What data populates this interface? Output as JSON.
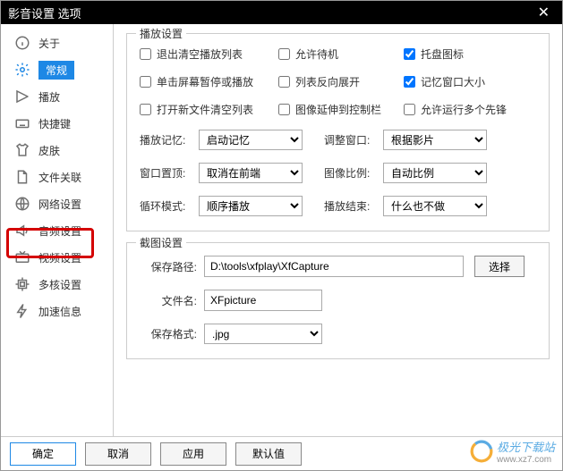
{
  "titlebar": {
    "title": "影音设置 选项"
  },
  "sidebar": {
    "items": [
      {
        "label": "关于"
      },
      {
        "label": "常规"
      },
      {
        "label": "播放"
      },
      {
        "label": "快捷键"
      },
      {
        "label": "皮肤"
      },
      {
        "label": "文件关联"
      },
      {
        "label": "网络设置"
      },
      {
        "label": "音频设置"
      },
      {
        "label": "视频设置"
      },
      {
        "label": "多核设置"
      },
      {
        "label": "加速信息"
      }
    ]
  },
  "playback": {
    "group_title": "播放设置",
    "checkboxes": {
      "clear_on_exit": "退出清空播放列表",
      "allow_standby": "允许待机",
      "tray_icon": "托盘图标",
      "click_pause": "单击屏幕暂停或播放",
      "list_reverse": "列表反向展开",
      "remember_size": "记忆窗口大小",
      "open_clear": "打开新文件清空列表",
      "extend_controls": "图像延伸到控制栏",
      "allow_multi": "允许运行多个先锋"
    },
    "selects": {
      "play_memory_label": "播放记忆:",
      "play_memory_value": "启动记忆",
      "adjust_window_label": "调整窗口:",
      "adjust_window_value": "根据影片",
      "window_top_label": "窗口置顶:",
      "window_top_value": "取消在前端",
      "image_ratio_label": "图像比例:",
      "image_ratio_value": "自动比例",
      "loop_mode_label": "循环模式:",
      "loop_mode_value": "顺序播放",
      "play_end_label": "播放结束:",
      "play_end_value": "什么也不做"
    }
  },
  "screenshot": {
    "group_title": "截图设置",
    "save_path_label": "保存路径:",
    "save_path_value": "D:\\tools\\xfplay\\XfCapture",
    "browse_label": "选择",
    "filename_label": "文件名:",
    "filename_value": "XFpicture",
    "format_label": "保存格式:",
    "format_value": ".jpg"
  },
  "footer": {
    "ok": "确定",
    "cancel": "取消",
    "apply": "应用",
    "default": "默认值"
  },
  "watermark": {
    "text": "极光下载站",
    "url": "www.xz7.com"
  }
}
